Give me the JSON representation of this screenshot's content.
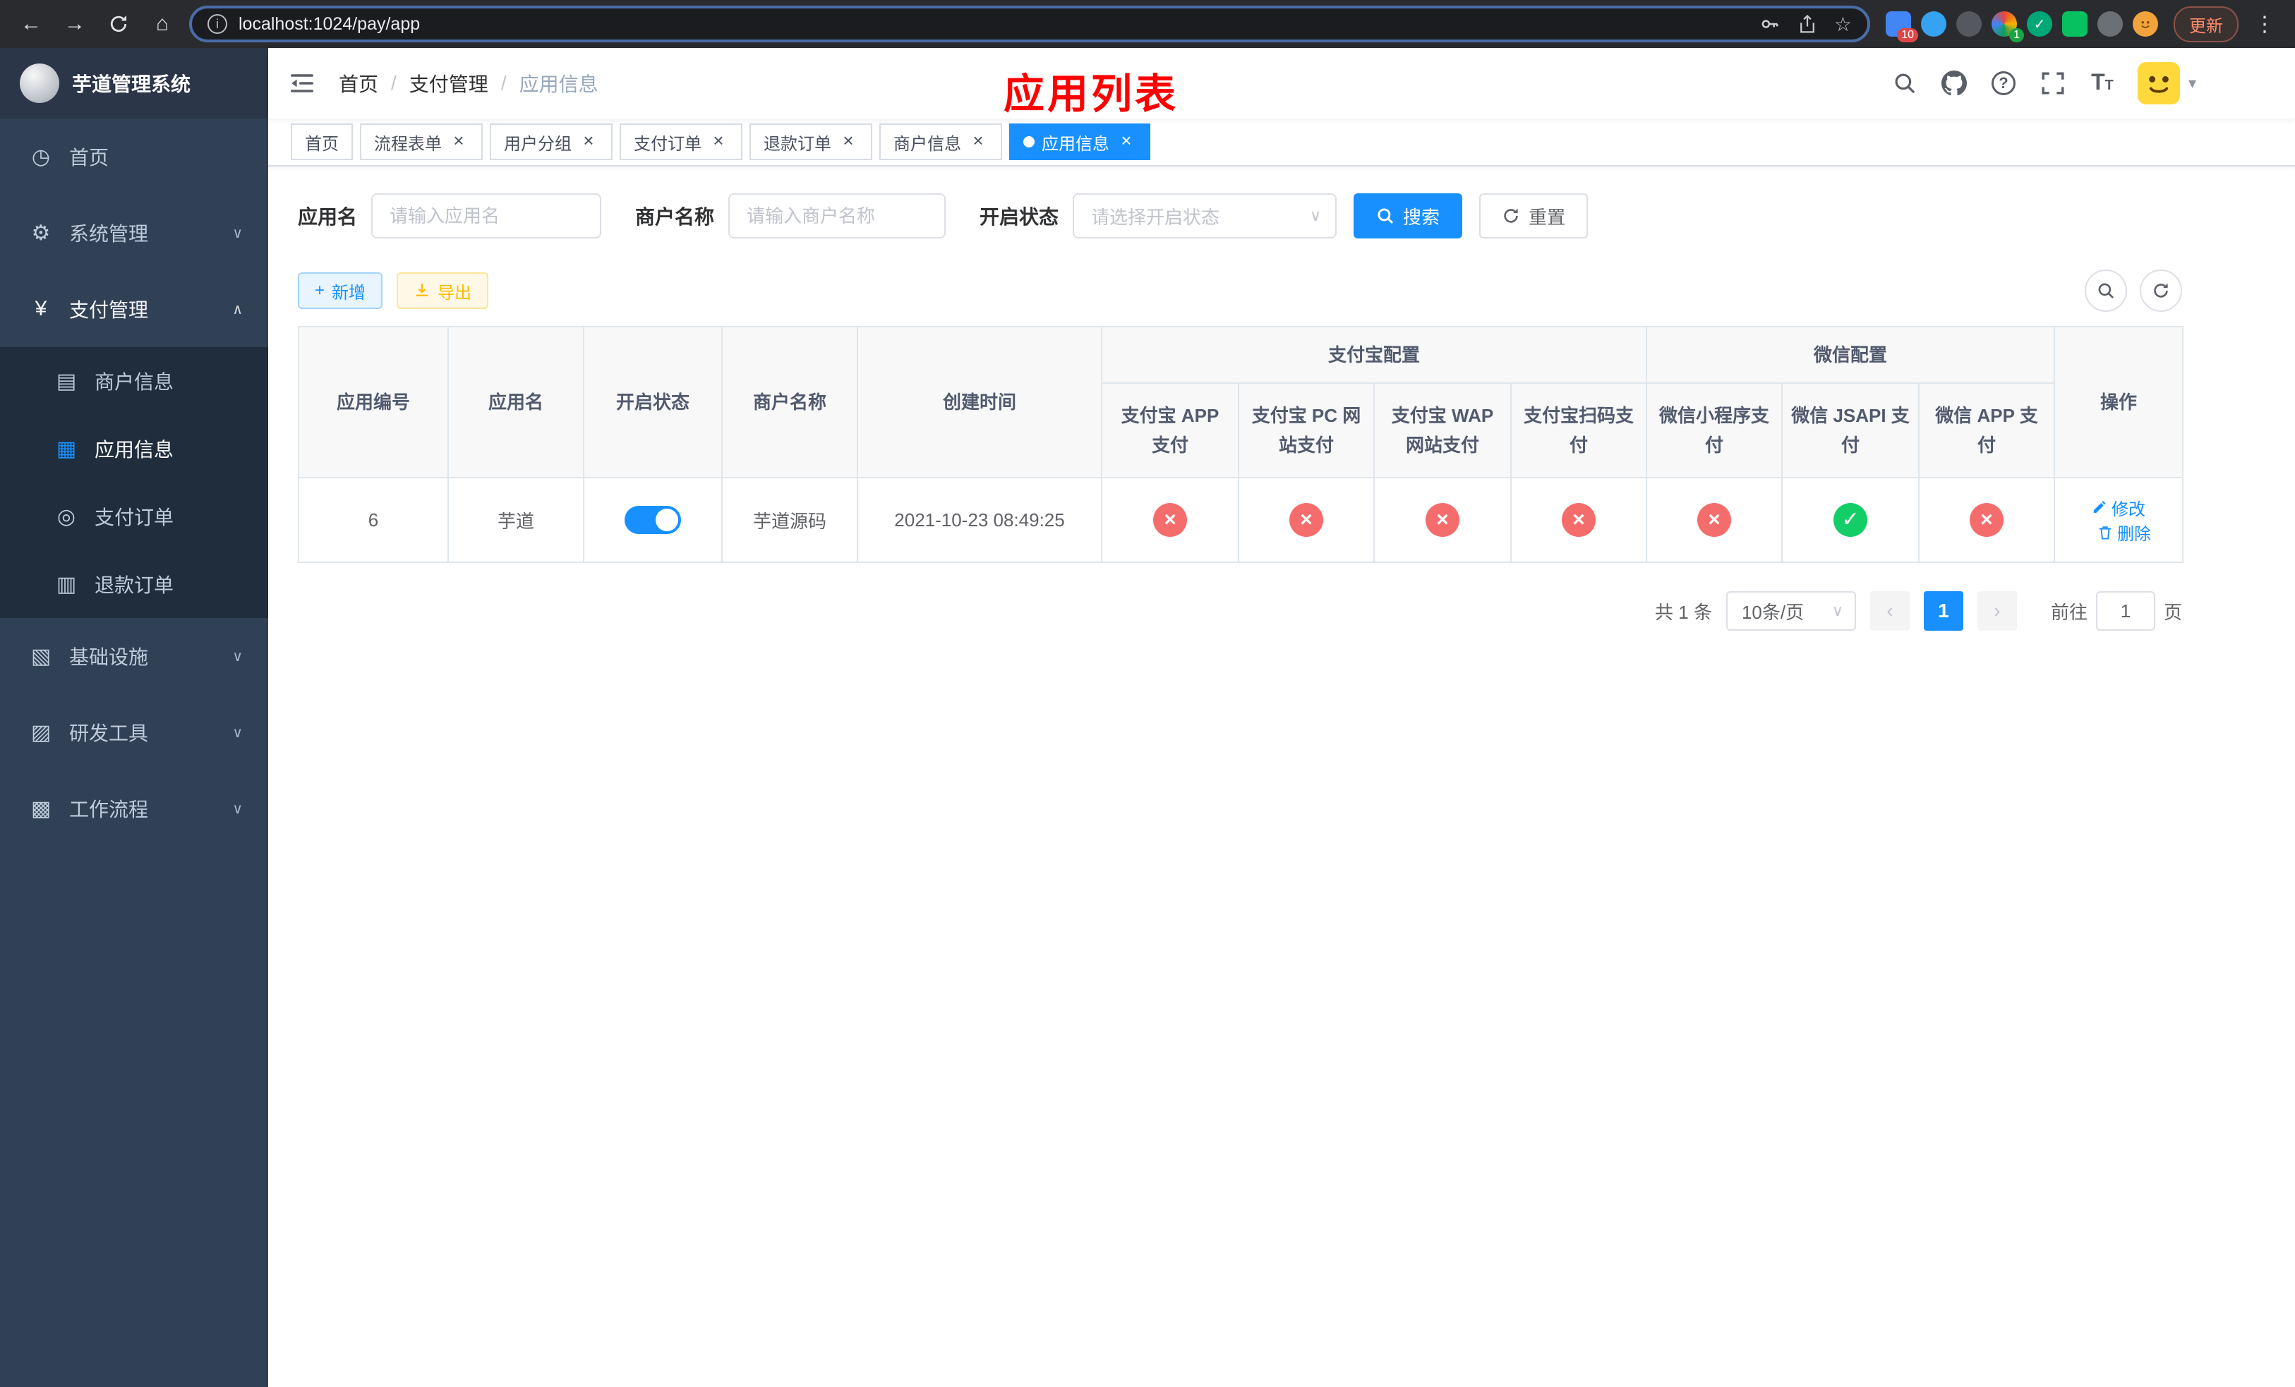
{
  "browser": {
    "url": "localhost:1024/pay/app",
    "update_label": "更新",
    "extension_badge_count": "10",
    "extension_badge_count_2": "1"
  },
  "sidebar": {
    "logo_title": "芋道管理系统",
    "menu": [
      {
        "label": "首页",
        "icon": "dashboard-icon"
      },
      {
        "label": "系统管理",
        "icon": "gear-icon",
        "has_children": true
      },
      {
        "label": "支付管理",
        "icon": "yen-icon",
        "has_children": true,
        "expanded": true
      },
      {
        "label": "商户信息",
        "icon": "merchant-card-icon",
        "submenu": true
      },
      {
        "label": "应用信息",
        "icon": "app-grid-icon",
        "submenu": true,
        "selected": true
      },
      {
        "label": "支付订单",
        "icon": "pay-order-icon",
        "submenu": true
      },
      {
        "label": "退款订单",
        "icon": "refund-order-icon",
        "submenu": true
      },
      {
        "label": "基础设施",
        "icon": "infrastructure-icon",
        "has_children": true
      },
      {
        "label": "研发工具",
        "icon": "devtools-icon",
        "has_children": true
      },
      {
        "label": "工作流程",
        "icon": "workflow-icon",
        "has_children": true
      }
    ]
  },
  "header": {
    "breadcrumb": [
      {
        "label": "首页"
      },
      {
        "label": "支付管理"
      },
      {
        "label": "应用信息"
      }
    ],
    "page_title": "应用列表"
  },
  "tabs": [
    {
      "label": "首页",
      "closable": false,
      "active": false
    },
    {
      "label": "流程表单",
      "closable": true,
      "active": false
    },
    {
      "label": "用户分组",
      "closable": true,
      "active": false
    },
    {
      "label": "支付订单",
      "closable": true,
      "active": false
    },
    {
      "label": "退款订单",
      "closable": true,
      "active": false
    },
    {
      "label": "商户信息",
      "closable": true,
      "active": false
    },
    {
      "label": "应用信息",
      "closable": true,
      "active": true
    }
  ],
  "filters": {
    "app_name_label": "应用名",
    "app_name_placeholder": "请输入应用名",
    "merchant_label": "商户名称",
    "merchant_placeholder": "请输入商户名称",
    "status_label": "开启状态",
    "status_placeholder": "请选择开启状态",
    "search_label": "搜索",
    "reset_label": "重置"
  },
  "toolbar": {
    "add_label": "新增",
    "export_label": "导出"
  },
  "table": {
    "group_headers": {
      "alipay": "支付宝配置",
      "wechat": "微信配置"
    },
    "columns": [
      "应用编号",
      "应用名",
      "开启状态",
      "商户名称",
      "创建时间",
      "支付宝 APP 支付",
      "支付宝 PC 网站支付",
      "支付宝 WAP 网站支付",
      "支付宝扫码支付",
      "微信小程序支付",
      "微信 JSAPI 支付",
      "微信 APP 支付",
      "操作"
    ],
    "rows": [
      {
        "id": "6",
        "name": "芋道",
        "enabled": true,
        "merchant": "芋道源码",
        "created_at": "2021-10-23 08:49:25",
        "alipay_app": "disabled",
        "alipay_pc": "disabled",
        "alipay_wap": "disabled",
        "alipay_qr": "disabled",
        "wechat_mini": "disabled",
        "wechat_jsapi": "enabled",
        "wechat_app": "disabled",
        "actions": [
          "修改",
          "删除"
        ]
      }
    ]
  },
  "pagination": {
    "total_label": "共 1 条",
    "page_size_label": "10条/页",
    "current_page": "1",
    "goto_label": "前往",
    "goto_value": "1",
    "goto_suffix": "页"
  },
  "colors": {
    "primary": "#1890ff",
    "success": "#13ce66",
    "danger": "#f56c6c",
    "warning": "#ffba00",
    "title_red": "#ff0000",
    "sidebar_bg": "#304156",
    "submenu_bg": "#1f2d3d"
  }
}
